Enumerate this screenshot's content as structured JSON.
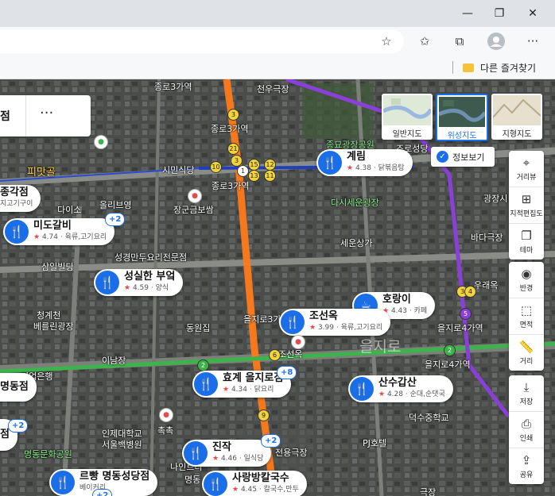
{
  "browser": {
    "window_controls": {
      "minimize": "—",
      "restore": "❐",
      "close": "✕"
    },
    "toolbar_icons": {
      "add_favorite": "☆",
      "favorites": "✩",
      "collections": "⧉",
      "more": "···"
    },
    "bookmark_folder": "다른 즐겨찾기"
  },
  "left_panel": {
    "partial_label": "점",
    "more": "···"
  },
  "map_types": [
    {
      "label": "일반지도",
      "selected": false
    },
    {
      "label": "위성지도",
      "selected": true
    },
    {
      "label": "지형지도",
      "selected": false
    }
  ],
  "info_view": {
    "label": "정보보기",
    "checked": true
  },
  "right_tools": {
    "group1": [
      "거리뷰",
      "지적편집도",
      "테마"
    ],
    "group2": [
      "반경",
      "면적",
      "거리"
    ],
    "group3": [
      "저장",
      "인쇄",
      "공유"
    ]
  },
  "places": [
    {
      "name": "계림",
      "rating": "4.38",
      "category": "닭볶음탕"
    },
    {
      "name": "미도갈비",
      "rating": "4.74",
      "category": "육류,고기요리",
      "extra": "+2"
    },
    {
      "name": "성실한 부엌",
      "rating": "4.59",
      "category": "양식"
    },
    {
      "name": "호랑이",
      "rating": "4.43",
      "category": "카페"
    },
    {
      "name": "조선옥",
      "rating": "3.99",
      "category": "육류,고기요리"
    },
    {
      "name": "효계 을지로점",
      "rating": "4.34",
      "category": "닭요리",
      "extra": "+8"
    },
    {
      "name": "산수갑산",
      "rating": "4.28",
      "category": "순대,순댓국"
    },
    {
      "name": "진작",
      "rating": "4.46",
      "category": "일식당",
      "extra": "+2"
    },
    {
      "name": "사랑방칼국수",
      "rating": "4.45",
      "category": "칼국수,만두"
    },
    {
      "name": "르빵 명동성당점",
      "rating": "",
      "category": "베이커리",
      "extra": "+2"
    },
    {
      "name": "종각점",
      "rating": "",
      "category": "지고기구이"
    },
    {
      "name": "명동점",
      "rating": "",
      "category": ""
    },
    {
      "name": "점",
      "rating": "",
      "category": "",
      "extra": "+2"
    }
  ],
  "map_labels": [
    "종로3가역",
    "천우극장",
    "종로3가역",
    "시민식당",
    "종로3가역",
    "종묘광장공원",
    "조로성당",
    "피맛골",
    "다이소",
    "올리브영",
    "장군금보쌈",
    "다시세운광장",
    "광장시",
    "세운상가",
    "바다극장",
    "삼일빌딩",
    "성경만두요리전문점",
    "우래옥",
    "청계천",
    "베를린광장",
    "동원집",
    "을지로3가역",
    "을지로4가역",
    "조선옥",
    "이남장",
    "을지로",
    "을지로4가역",
    "기업은행",
    "덕수중학교",
    "인제대학교",
    "서울백병원",
    "PJ호텔",
    "촉촉",
    "명동문화공원",
    "전용극장",
    "나인트리",
    "명동",
    "극장"
  ],
  "stations": {
    "stop_1": "1",
    "stop_3": "3",
    "stop_4": "4",
    "stop_5": "5",
    "stop_2": "2",
    "stop_6": "6",
    "stop_9": "9",
    "stop_10": "10",
    "stop_11": "11",
    "stop_12": "12",
    "stop_13": "13",
    "stop_15": "15",
    "stop_21": "21"
  },
  "colors": {
    "brand": "#1a6fe8",
    "rating_star": "#e94848",
    "line2": "#3cb44b",
    "line3": "#ff7a1a",
    "line5": "#8b3fd9"
  }
}
